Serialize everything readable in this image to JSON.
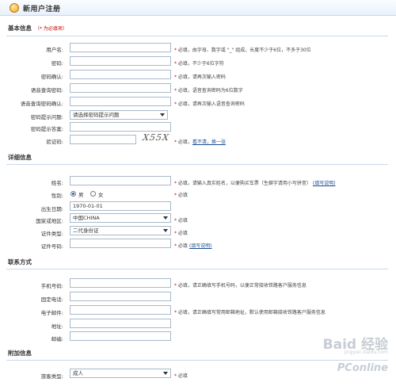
{
  "window": {
    "title": "新用户注册"
  },
  "sections": {
    "basic": {
      "title": "基本信息",
      "hint": "（* 为必填项）"
    },
    "detail": {
      "title": "详细信息"
    },
    "contact": {
      "title": "联系方式"
    },
    "extra": {
      "title": "附加信息"
    }
  },
  "basic_fields": {
    "username": {
      "label": "用户名:",
      "hint": "必填，由字母、数字或 \"_\" 组成，长度不少于6位，不多于30位"
    },
    "password": {
      "label": "密码:",
      "hint": "必填，不少于6位字符"
    },
    "password_confirm": {
      "label": "密码确认:",
      "hint": "必填，请再次输入密码"
    },
    "voice_password": {
      "label": "语音查询密码:",
      "hint": "必填，语音查询密码为6位数字"
    },
    "voice_password_confirm": {
      "label": "语音查询密码确认:",
      "hint": "必填，请再次输入语音查询密码"
    },
    "security_question": {
      "label": "密码提示问题:",
      "value": "请选择密码提示问题"
    },
    "security_answer": {
      "label": "密码提示答案:"
    },
    "captcha": {
      "label": "验证码:",
      "image_text": "X55X",
      "hint_prefix": "必填，",
      "refresh_link": "看不清，换一张"
    }
  },
  "detail_fields": {
    "name": {
      "label": "姓名:",
      "hint": "必填，请输入真实姓名，以便购买车票（生僻字请用小写拼音）",
      "link": "(填写说明)"
    },
    "gender": {
      "label": "性别:",
      "male": "男",
      "female": "女",
      "selected": "male",
      "hint": "必填"
    },
    "birthdate": {
      "label": "出生日期:",
      "value": "1970-01-01"
    },
    "country": {
      "label": "国家或地区:",
      "value": "中国CHINA",
      "hint": "必填"
    },
    "id_type": {
      "label": "证件类型:",
      "value": "二代身份证",
      "hint": "必填"
    },
    "id_number": {
      "label": "证件号码:",
      "hint": "必填",
      "link": "(填写说明)"
    }
  },
  "contact_fields": {
    "mobile": {
      "label": "手机号码:",
      "hint": "必填，请正确填写手机号码，以便正常接收铁路客户服务信息"
    },
    "phone": {
      "label": "固定电话:"
    },
    "email": {
      "label": "电子邮件:",
      "hint": "必填，请正确填写常用邮箱地址，默认使用邮箱接收铁路客户服务信息"
    },
    "address": {
      "label": "地址:"
    },
    "postcode": {
      "label": "邮编:"
    }
  },
  "extra_fields": {
    "passenger_type": {
      "label": "旅客类型:",
      "value": "成人",
      "hint": "必填"
    }
  },
  "watermarks": {
    "baidu": "Baid 经验",
    "baidu_url": "jingyan.baidu.com",
    "pconline": "PConline"
  },
  "colors": {
    "required_star": "#dd0000",
    "link": "#1a4f93",
    "rule": "#c8d8ea"
  }
}
